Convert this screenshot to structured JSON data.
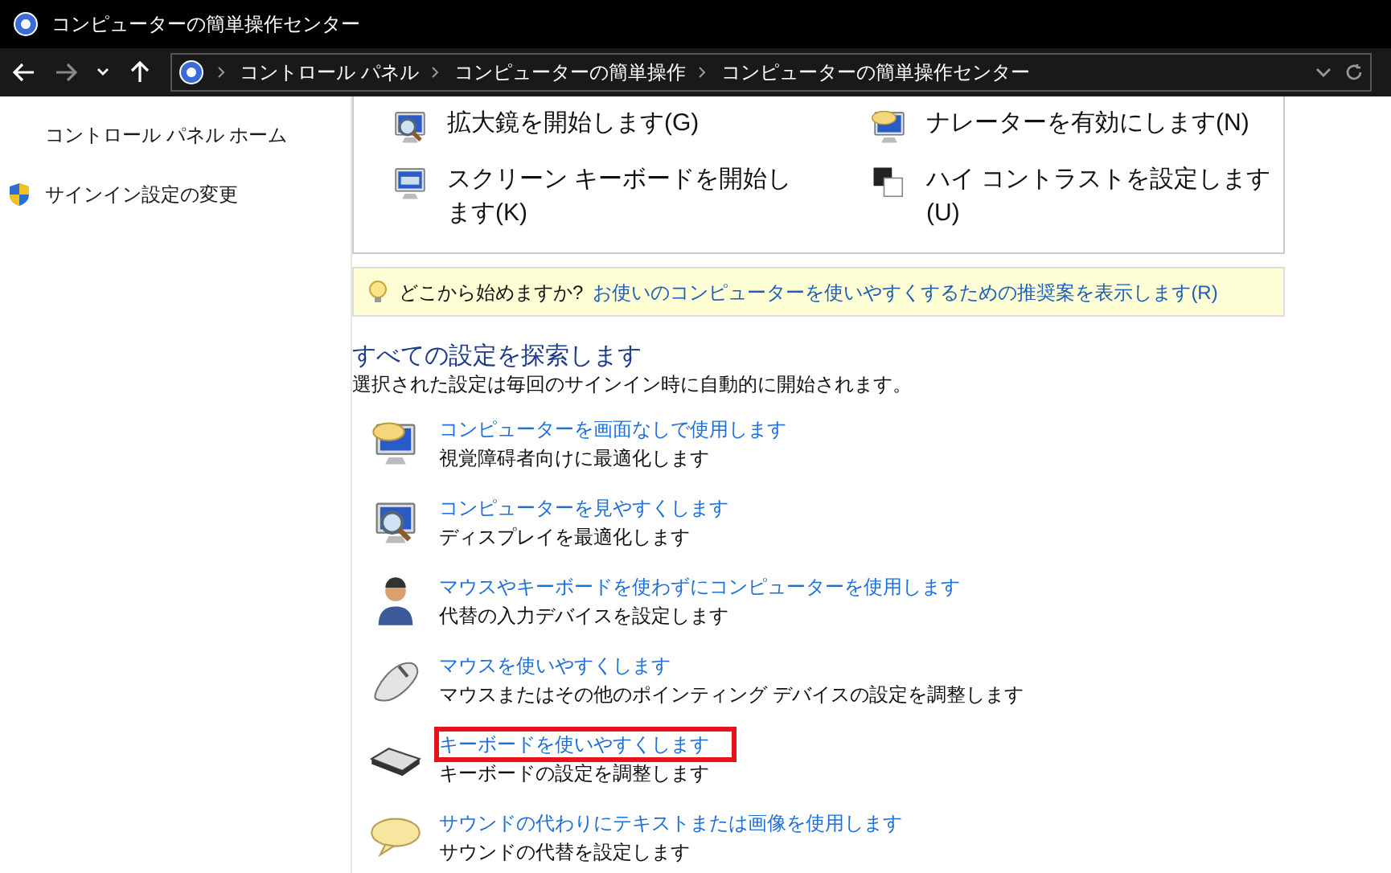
{
  "window": {
    "title": "コンピューターの簡単操作センター"
  },
  "address_bar": {
    "crumbs": [
      "コントロール パネル",
      "コンピューターの簡単操作",
      "コンピューターの簡単操作センター"
    ]
  },
  "sidebar": {
    "items": [
      {
        "label": "コントロール パネル ホーム",
        "kind": "plain"
      },
      {
        "label": "サインイン設定の変更",
        "kind": "shield"
      }
    ]
  },
  "quick_access": [
    {
      "label": "拡大鏡を開始します(G)",
      "kind": "magnifier"
    },
    {
      "label": "ナレーターを有効にします(N)",
      "kind": "narrator"
    },
    {
      "label": "スクリーン キーボードを開始します(K)",
      "kind": "keyboard-screen"
    },
    {
      "label": "ハイ コントラストを設定します(U)",
      "kind": "contrast"
    }
  ],
  "tip": {
    "prefix": "どこから始めますか?",
    "link": "お使いのコンピューターを使いやすくするための推奨案を表示します(R)"
  },
  "section": {
    "title": "すべての設定を探索します",
    "subtitle": "選択された設定は毎回のサインイン時に自動的に開始されます。"
  },
  "settings": [
    {
      "link": "コンピューターを画面なしで使用します",
      "description": "視覚障碍者向けに最適化します",
      "kind": "speech-monitor",
      "highlighted": false
    },
    {
      "link": "コンピューターを見やすくします",
      "description": "ディスプレイを最適化します",
      "kind": "magnifier-monitor",
      "highlighted": false
    },
    {
      "link": "マウスやキーボードを使わずにコンピューターを使用します",
      "description": "代替の入力デバイスを設定します",
      "kind": "person",
      "highlighted": false
    },
    {
      "link": "マウスを使いやすくします",
      "description": "マウスまたはその他のポインティング デバイスの設定を調整します",
      "kind": "mouse",
      "highlighted": false
    },
    {
      "link": "キーボードを使いやすくします",
      "description": "キーボードの設定を調整します",
      "kind": "keyboard",
      "highlighted": true
    },
    {
      "link": "サウンドの代わりにテキストまたは画像を使用します",
      "description": "サウンドの代替を設定します",
      "kind": "bubble",
      "highlighted": false
    }
  ]
}
